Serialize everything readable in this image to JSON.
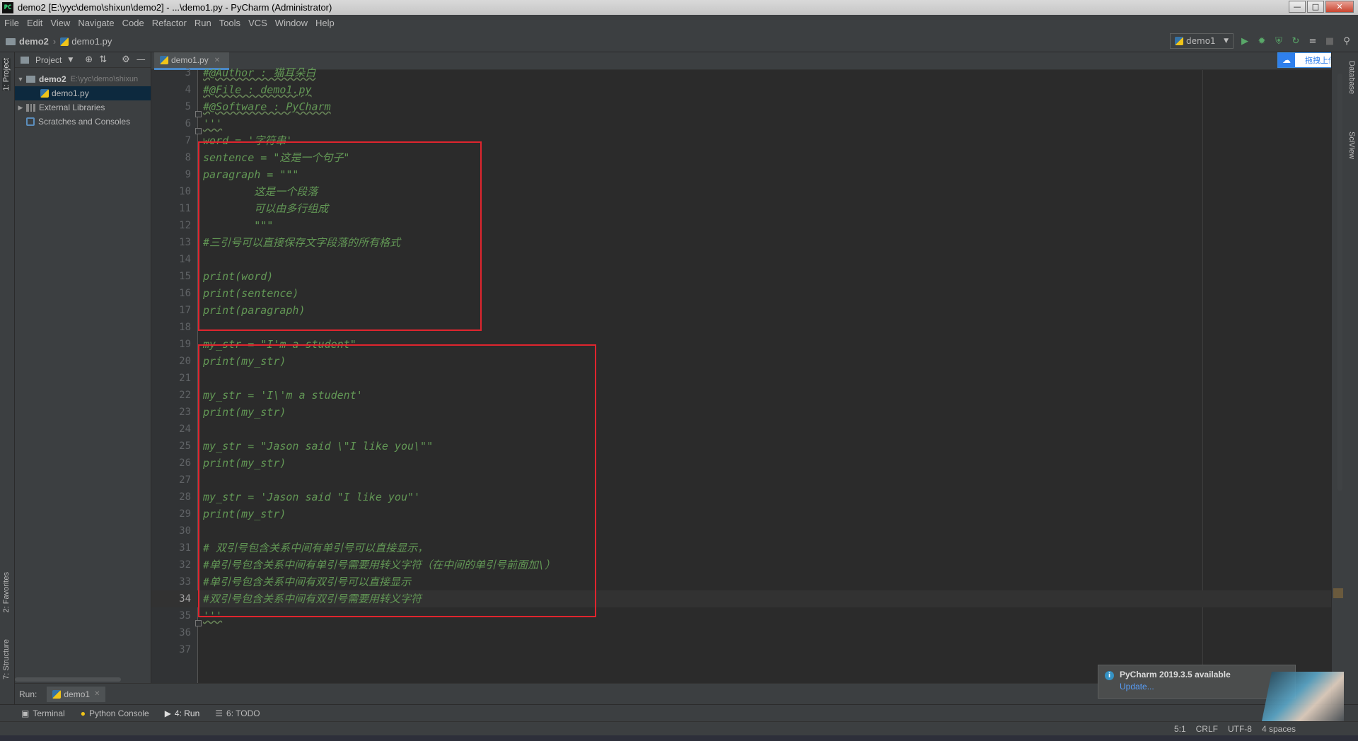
{
  "window": {
    "title": "demo2 [E:\\yyc\\demo\\shixun\\demo2] - ...\\demo1.py - PyCharm (Administrator)",
    "app_icon": "PC"
  },
  "menu": [
    "File",
    "Edit",
    "View",
    "Navigate",
    "Code",
    "Refactor",
    "Run",
    "Tools",
    "VCS",
    "Window",
    "Help"
  ],
  "breadcrumb": {
    "project": "demo2",
    "file": "demo1.py"
  },
  "run_config": {
    "name": "demo1"
  },
  "left_strip": {
    "project": "1: Project",
    "favorites": "2: Favorites",
    "structure": "7: Structure"
  },
  "right_strip": {
    "database": "Database",
    "sciview": "SciView"
  },
  "project_panel": {
    "title": "Project",
    "tree": [
      {
        "label": "demo2",
        "hint": "E:\\yyc\\demo\\shixun"
      },
      {
        "label": "demo1.py"
      },
      {
        "label": "External Libraries"
      },
      {
        "label": "Scratches and Consoles"
      }
    ]
  },
  "editor_tab": {
    "name": "demo1.py"
  },
  "upload_widget": {
    "label": "拖拽上传"
  },
  "code_lines": [
    {
      "n": "3",
      "text": "#@Author : 猫耳朵白"
    },
    {
      "n": "4",
      "text": "#@File : demo1.py"
    },
    {
      "n": "5",
      "text": "#@Software : PyCharm"
    },
    {
      "n": "6",
      "text": "'''"
    },
    {
      "n": "7",
      "text": "word = '字符串'"
    },
    {
      "n": "8",
      "text": "sentence = \"这是一个句子\""
    },
    {
      "n": "9",
      "text": "paragraph = \"\"\""
    },
    {
      "n": "10",
      "text": "        这是一个段落"
    },
    {
      "n": "11",
      "text": "        可以由多行组成"
    },
    {
      "n": "12",
      "text": "        \"\"\""
    },
    {
      "n": "13",
      "text": "#三引号可以直接保存文字段落的所有格式"
    },
    {
      "n": "14",
      "text": ""
    },
    {
      "n": "15",
      "text": "print(word)"
    },
    {
      "n": "16",
      "text": "print(sentence)"
    },
    {
      "n": "17",
      "text": "print(paragraph)"
    },
    {
      "n": "18",
      "text": ""
    },
    {
      "n": "19",
      "text": "my_str = \"I'm a student\""
    },
    {
      "n": "20",
      "text": "print(my_str)"
    },
    {
      "n": "21",
      "text": ""
    },
    {
      "n": "22",
      "text": "my_str = 'I\\'m a student'"
    },
    {
      "n": "23",
      "text": "print(my_str)"
    },
    {
      "n": "24",
      "text": ""
    },
    {
      "n": "25",
      "text": "my_str = \"Jason said \\\"I like you\\\"\""
    },
    {
      "n": "26",
      "text": "print(my_str)"
    },
    {
      "n": "27",
      "text": ""
    },
    {
      "n": "28",
      "text": "my_str = 'Jason said \"I like you\"'"
    },
    {
      "n": "29",
      "text": "print(my_str)"
    },
    {
      "n": "30",
      "text": ""
    },
    {
      "n": "31",
      "text": "# 双引号包含关系中间有单引号可以直接显示，"
    },
    {
      "n": "32",
      "text": "#单引号包含关系中间有单引号需要用转义字符（在中间的单引号前面加\\）"
    },
    {
      "n": "33",
      "text": "#单引号包含关系中间有双引号可以直接显示"
    },
    {
      "n": "34",
      "text": "#双引号包含关系中间有双引号需要用转义字符"
    },
    {
      "n": "35",
      "text": "'''"
    },
    {
      "n": "36",
      "text": ""
    },
    {
      "n": "37",
      "text": ""
    }
  ],
  "current_line": "34",
  "run_panel": {
    "label": "Run:",
    "tab": "demo1"
  },
  "tool_tabs": [
    "Terminal",
    "Python Console",
    "4: Run",
    "6: TODO"
  ],
  "notification": {
    "title": "PyCharm 2019.3.5 available",
    "link": "Update..."
  },
  "status": {
    "position": "5:1",
    "line_sep": "CRLF",
    "encoding": "UTF-8",
    "indent": "4 spaces"
  },
  "colors": {
    "comment_green": "#629755",
    "highlight_red": "#e0252e",
    "bg": "#2b2b2b",
    "panel": "#3c3f41"
  }
}
